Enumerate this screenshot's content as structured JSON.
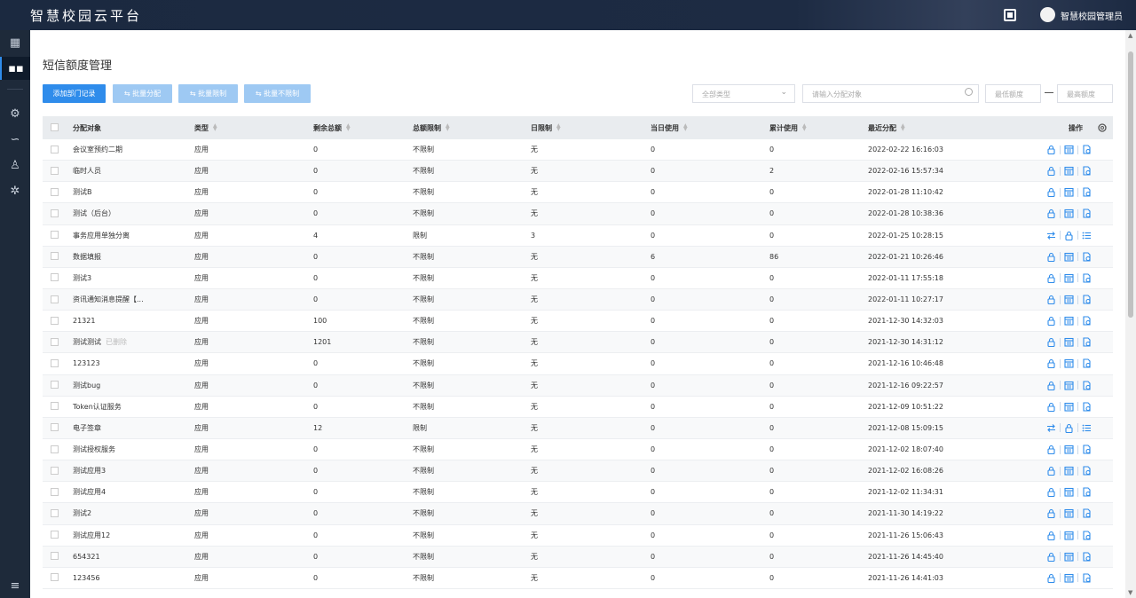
{
  "app": {
    "title": "智慧校园云平台",
    "user": "智慧校园管理员"
  },
  "page": {
    "title": "短信额度管理"
  },
  "toolbar": {
    "add": "添加部门记录",
    "batch_assign": "⇆ 批量分配",
    "batch_limit": "⇆ 批量限制",
    "batch_unlimit": "⇆ 批量不限制",
    "type_select": "全部类型",
    "search_placeholder": "请输入分配对象",
    "min_placeholder": "最低额度",
    "max_placeholder": "最高额度"
  },
  "columns": [
    "分配对象",
    "类型",
    "剩余总额",
    "总额限制",
    "日限制",
    "当日使用",
    "累计使用",
    "最近分配",
    "操作"
  ],
  "rows": [
    {
      "name": "会议室预约二期",
      "type": "应用",
      "remain": "0",
      "total_limit": "不限制",
      "day_limit": "无",
      "today": "0",
      "total": "0",
      "last": "2022-02-22 16:16:03",
      "ops": "std"
    },
    {
      "name": "临时人员",
      "type": "应用",
      "remain": "0",
      "total_limit": "不限制",
      "day_limit": "无",
      "today": "0",
      "total": "2",
      "last": "2022-02-16 15:57:34",
      "ops": "std"
    },
    {
      "name": "测试B",
      "type": "应用",
      "remain": "0",
      "total_limit": "不限制",
      "day_limit": "无",
      "today": "0",
      "total": "0",
      "last": "2022-01-28 11:10:42",
      "ops": "std"
    },
    {
      "name": "测试（后台）",
      "type": "应用",
      "remain": "0",
      "total_limit": "不限制",
      "day_limit": "无",
      "today": "0",
      "total": "0",
      "last": "2022-01-28 10:38:36",
      "ops": "std"
    },
    {
      "name": "事务应用单独分离",
      "type": "应用",
      "remain": "4",
      "total_limit": "限制",
      "day_limit": "3",
      "today": "0",
      "total": "0",
      "last": "2022-01-25 10:28:15",
      "ops": "alt"
    },
    {
      "name": "数据填报",
      "type": "应用",
      "remain": "0",
      "total_limit": "不限制",
      "day_limit": "无",
      "today": "6",
      "total": "86",
      "last": "2022-01-21 10:26:46",
      "ops": "std"
    },
    {
      "name": "测试3",
      "type": "应用",
      "remain": "0",
      "total_limit": "不限制",
      "day_limit": "无",
      "today": "0",
      "total": "0",
      "last": "2022-01-11 17:55:18",
      "ops": "std"
    },
    {
      "name": "资讯通知消息提醒【...",
      "type": "应用",
      "remain": "0",
      "total_limit": "不限制",
      "day_limit": "无",
      "today": "0",
      "total": "0",
      "last": "2022-01-11 10:27:17",
      "ops": "std"
    },
    {
      "name": "21321",
      "type": "应用",
      "remain": "100",
      "total_limit": "不限制",
      "day_limit": "无",
      "today": "0",
      "total": "0",
      "last": "2021-12-30 14:32:03",
      "ops": "std"
    },
    {
      "name": "测试测试",
      "deleted": "已删除",
      "type": "应用",
      "remain": "1201",
      "total_limit": "不限制",
      "day_limit": "无",
      "today": "0",
      "total": "0",
      "last": "2021-12-30 14:31:12",
      "ops": "std"
    },
    {
      "name": "123123",
      "type": "应用",
      "remain": "0",
      "total_limit": "不限制",
      "day_limit": "无",
      "today": "0",
      "total": "0",
      "last": "2021-12-16 10:46:48",
      "ops": "std"
    },
    {
      "name": "测试bug",
      "type": "应用",
      "remain": "0",
      "total_limit": "不限制",
      "day_limit": "无",
      "today": "0",
      "total": "0",
      "last": "2021-12-16 09:22:57",
      "ops": "std"
    },
    {
      "name": "Token认证服务",
      "type": "应用",
      "remain": "0",
      "total_limit": "不限制",
      "day_limit": "无",
      "today": "0",
      "total": "0",
      "last": "2021-12-09 10:51:22",
      "ops": "std"
    },
    {
      "name": "电子签章",
      "type": "应用",
      "remain": "12",
      "total_limit": "限制",
      "day_limit": "无",
      "today": "0",
      "total": "0",
      "last": "2021-12-08 15:09:15",
      "ops": "alt"
    },
    {
      "name": "测试授权服务",
      "type": "应用",
      "remain": "0",
      "total_limit": "不限制",
      "day_limit": "无",
      "today": "0",
      "total": "0",
      "last": "2021-12-02 18:07:40",
      "ops": "std"
    },
    {
      "name": "测试应用3",
      "type": "应用",
      "remain": "0",
      "total_limit": "不限制",
      "day_limit": "无",
      "today": "0",
      "total": "0",
      "last": "2021-12-02 16:08:26",
      "ops": "std"
    },
    {
      "name": "测试应用4",
      "type": "应用",
      "remain": "0",
      "total_limit": "不限制",
      "day_limit": "无",
      "today": "0",
      "total": "0",
      "last": "2021-12-02 11:34:31",
      "ops": "std"
    },
    {
      "name": "测试2",
      "type": "应用",
      "remain": "0",
      "total_limit": "不限制",
      "day_limit": "无",
      "today": "0",
      "total": "0",
      "last": "2021-11-30 14:19:22",
      "ops": "std"
    },
    {
      "name": "测试应用12",
      "type": "应用",
      "remain": "0",
      "total_limit": "不限制",
      "day_limit": "无",
      "today": "0",
      "total": "0",
      "last": "2021-11-26 15:06:43",
      "ops": "std"
    },
    {
      "name": "654321",
      "type": "应用",
      "remain": "0",
      "total_limit": "不限制",
      "day_limit": "无",
      "today": "0",
      "total": "0",
      "last": "2021-11-26 14:45:40",
      "ops": "std"
    },
    {
      "name": "123456",
      "type": "应用",
      "remain": "0",
      "total_limit": "不限制",
      "day_limit": "无",
      "today": "0",
      "total": "0",
      "last": "2021-11-26 14:41:03",
      "ops": "std"
    }
  ],
  "colors": {
    "accent": "#2f8ceb",
    "sidebar": "#1e2a3a",
    "topbar": "#1b2940"
  }
}
